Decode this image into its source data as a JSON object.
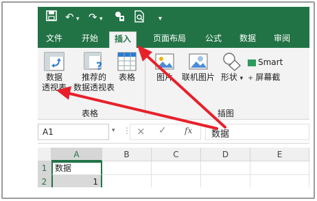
{
  "quick_access": {
    "save_icon": "save-icon",
    "undo_icon": "undo-icon",
    "redo_icon": "redo-icon",
    "touch_icon": "touch-mode-icon",
    "preview_icon": "print-preview-icon",
    "customize_icon": "customize-qat-icon"
  },
  "tabs": [
    "文件",
    "开始",
    "插入",
    "页面布局",
    "公式",
    "数据",
    "审阅"
  ],
  "active_tab": "插入",
  "ribbon": {
    "pivot_line1": "数据",
    "pivot_line2": "透视表",
    "rec_line1": "推荐的",
    "rec_line2": "数据透视表",
    "table": "表格",
    "group_tables": "表格",
    "picture": "图片",
    "online_picture": "联机图片",
    "shapes": "形状",
    "group_illustrations": "插图",
    "smartart": "Smart",
    "screenshot": "屏幕截"
  },
  "formula_bar": {
    "name_box": "A1",
    "cancel_glyph": "×",
    "enter_glyph": "✓",
    "fx_glyph": "fx",
    "content": "数据"
  },
  "grid": {
    "columns": [
      "A",
      "B",
      "C",
      "D",
      "E"
    ],
    "rows": [
      {
        "num": "1",
        "a": "数据"
      },
      {
        "num": "2",
        "a": "1"
      }
    ]
  },
  "colors": {
    "accent": "#217346",
    "arrow": "#e8202a"
  }
}
